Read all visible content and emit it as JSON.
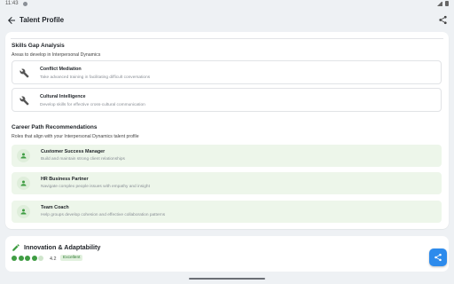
{
  "status_bar": {
    "time": "11:43"
  },
  "app_bar": {
    "title": "Talent Profile",
    "back_icon": "arrow-back-icon",
    "share_icon": "share-icon"
  },
  "skills_gap": {
    "title": "Skills Gap Analysis",
    "subtitle": "Areas to develop in Interpersonal Dynamics",
    "items": [
      {
        "title": "Conflict Mediation",
        "description": "Take advanced training in facilitating difficult conversations",
        "icon": "wrench-icon"
      },
      {
        "title": "Cultural Intelligence",
        "description": "Develop skills for effective cross-cultural communication",
        "icon": "wrench-icon"
      }
    ]
  },
  "career_path": {
    "title": "Career Path Recommendations",
    "subtitle": "Roles that align with your Interpersonal Dynamics talent profile",
    "items": [
      {
        "title": "Customer Success Manager",
        "description": "Build and maintain strong client relationships",
        "icon": "person-icon"
      },
      {
        "title": "HR Business Partner",
        "description": "Navigate complex people issues with empathy and insight",
        "icon": "person-icon"
      },
      {
        "title": "Team Coach",
        "description": "Help groups develop cohesion and effective collaboration patterns",
        "icon": "person-icon"
      }
    ]
  },
  "innovation": {
    "title": "Innovation & Adaptability",
    "icon": "pencil-icon",
    "rating_value": 4,
    "rating_max": 5,
    "score": "4.2",
    "badge": "Excellent"
  },
  "fab": {
    "icon": "share-icon"
  },
  "colors": {
    "accent_green": "#3f9d43",
    "fab_blue": "#2d8bec",
    "role_bg": "#edf6ea"
  }
}
